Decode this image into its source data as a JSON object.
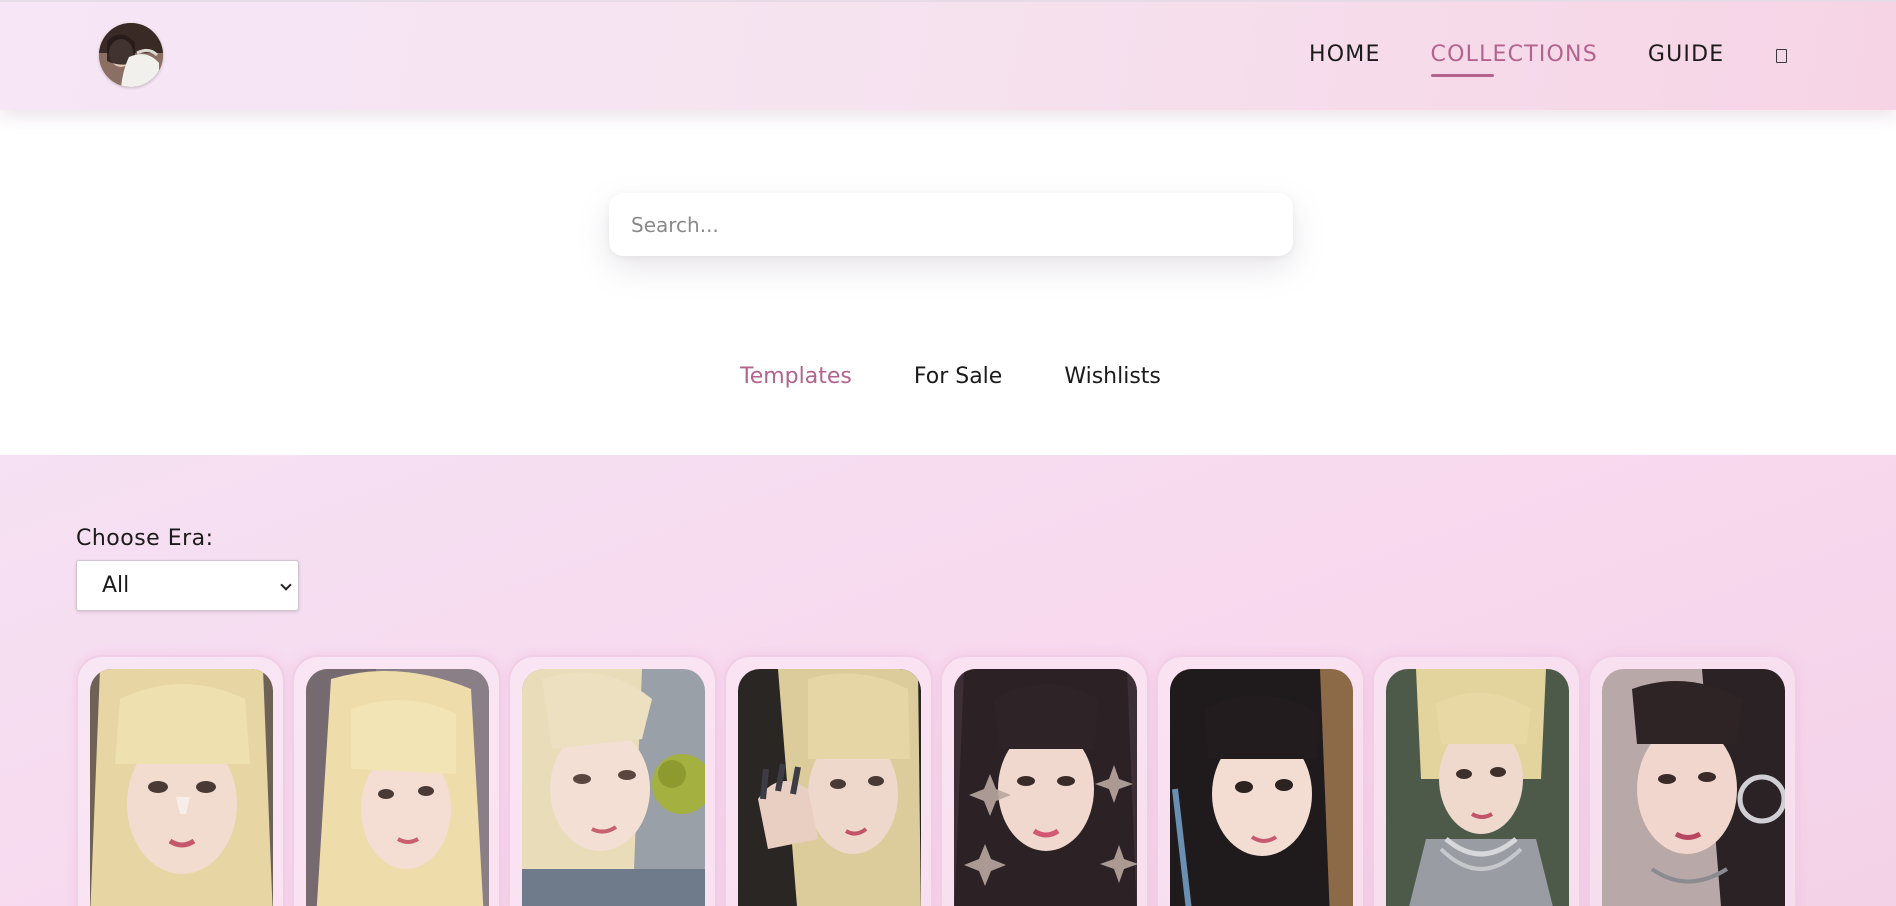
{
  "header": {
    "avatar_icon": "profile-avatar",
    "nav": [
      {
        "label": "HOME",
        "active": false
      },
      {
        "label": "COLLECTIONS",
        "active": true
      },
      {
        "label": "GUIDE",
        "active": false
      }
    ],
    "cart_icon": "box-icon"
  },
  "search": {
    "placeholder": "Search...",
    "value": ""
  },
  "tabs": [
    {
      "label": "Templates",
      "active": true
    },
    {
      "label": "For Sale",
      "active": false
    },
    {
      "label": "Wishlists",
      "active": false
    }
  ],
  "filter": {
    "label": "Choose Era:",
    "selected": "All"
  },
  "cards": [
    {
      "icon": "photocard-image"
    },
    {
      "icon": "photocard-image"
    },
    {
      "icon": "photocard-image"
    },
    {
      "icon": "photocard-image"
    },
    {
      "icon": "photocard-image"
    },
    {
      "icon": "photocard-image"
    },
    {
      "icon": "photocard-image"
    },
    {
      "icon": "photocard-image"
    }
  ],
  "colors": {
    "accent": "#b3638d",
    "header_bg": "#f6e3f0",
    "gallery_bg": "#f8d9ee",
    "card_border": "#f0cfe6"
  }
}
